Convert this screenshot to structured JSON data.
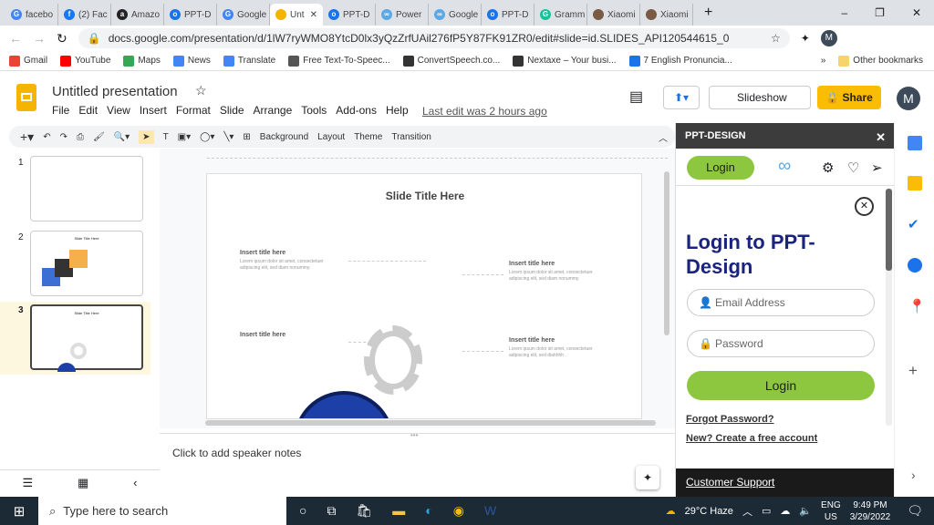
{
  "browser": {
    "tabs": [
      {
        "label": "facebo",
        "color": "#4285f4",
        "glyph": "G"
      },
      {
        "label": "(2) Fac",
        "color": "#1877f2",
        "glyph": "f"
      },
      {
        "label": "Amazo",
        "color": "#222",
        "glyph": "a"
      },
      {
        "label": "PPT-D",
        "color": "#1a73e8",
        "glyph": "o"
      },
      {
        "label": "Google",
        "color": "#4285f4",
        "glyph": "G"
      },
      {
        "label": "Unt",
        "color": "#f4b400",
        "glyph": "",
        "active": true
      },
      {
        "label": "PPT-D",
        "color": "#1a73e8",
        "glyph": "o"
      },
      {
        "label": "Power",
        "color": "#5aa9e6",
        "glyph": "∞"
      },
      {
        "label": "Google",
        "color": "#5aa9e6",
        "glyph": "∞"
      },
      {
        "label": "PPT-D",
        "color": "#1a73e8",
        "glyph": "o"
      },
      {
        "label": "Gramm",
        "color": "#15c39a",
        "glyph": "G"
      },
      {
        "label": "Xiaomi",
        "color": "#7a5a44",
        "glyph": ""
      },
      {
        "label": "Xiaomi",
        "color": "#7a5a44",
        "glyph": ""
      }
    ],
    "url": "docs.google.com/presentation/d/1lW7ryWMO8YtcD0lx3yQzZrfUAil276fP5Y87FK91ZR0/edit#slide=id.SLIDES_API120544615_0",
    "profile_initial": "M",
    "bookmarks": [
      {
        "label": "Gmail",
        "color": "#ea4335"
      },
      {
        "label": "YouTube",
        "color": "#ff0000"
      },
      {
        "label": "Maps",
        "color": "#34a853"
      },
      {
        "label": "News",
        "color": "#4285f4"
      },
      {
        "label": "Translate",
        "color": "#4285f4"
      },
      {
        "label": "Free Text-To-Speec...",
        "color": "#555"
      },
      {
        "label": "ConvertSpeech.co...",
        "color": "#333"
      },
      {
        "label": "Nextaxe – Your busi...",
        "color": "#333"
      },
      {
        "label": "7 English Pronuncia...",
        "color": "#1a73e8"
      }
    ],
    "other_bookmarks": "Other bookmarks"
  },
  "docs": {
    "title": "Untitled presentation",
    "menu": [
      "File",
      "Edit",
      "View",
      "Insert",
      "Format",
      "Slide",
      "Arrange",
      "Tools",
      "Add-ons",
      "Help"
    ],
    "last_edit": "Last edit was 2 hours ago",
    "slideshow": "Slideshow",
    "share": "Share",
    "avatar": "M",
    "toolbar": {
      "background": "Background",
      "layout": "Layout",
      "theme": "Theme",
      "transition": "Transition"
    }
  },
  "filmstrip": {
    "slides": [
      "1",
      "2",
      "3"
    ],
    "selected": "3",
    "thumb2_title": "Slide Title Here",
    "thumb3_title": "Slide Title Here"
  },
  "slide": {
    "title": "Slide Title Here",
    "items": [
      {
        "title": "Insert title here",
        "body": "Lorem ipsum dolor sit amet, consectetuer adipiscing elit, sed diam nonummy."
      },
      {
        "title": "Insert title here",
        "body": "Lorem ipsum dolor sit amet, consectetuer adipiscing elit, sed diam nonummy."
      },
      {
        "title": "Insert title here",
        "body": ""
      },
      {
        "title": "Insert title here",
        "body": "Lorem ipsum dolor sit amet, consectetuer adipiscing elit, sed diahhhh ."
      }
    ]
  },
  "notes": {
    "placeholder": "Click to add speaker notes"
  },
  "panel": {
    "header": "PPT-DESIGN",
    "login_tab": "Login",
    "heading": "Login to PPT-Design",
    "email_placeholder": "Email Address",
    "password_placeholder": "Password",
    "login_button": "Login",
    "forgot": "Forgot Password?",
    "create": "New? Create a free account",
    "support": "Customer Support",
    "accent": "#8dc63f",
    "heading_color": "#1a237e"
  },
  "taskbar": {
    "search_placeholder": "Type here to search",
    "weather": "29°C  Haze",
    "lang1": "ENG",
    "lang2": "US",
    "time": "9:49 PM",
    "date": "3/29/2022"
  }
}
